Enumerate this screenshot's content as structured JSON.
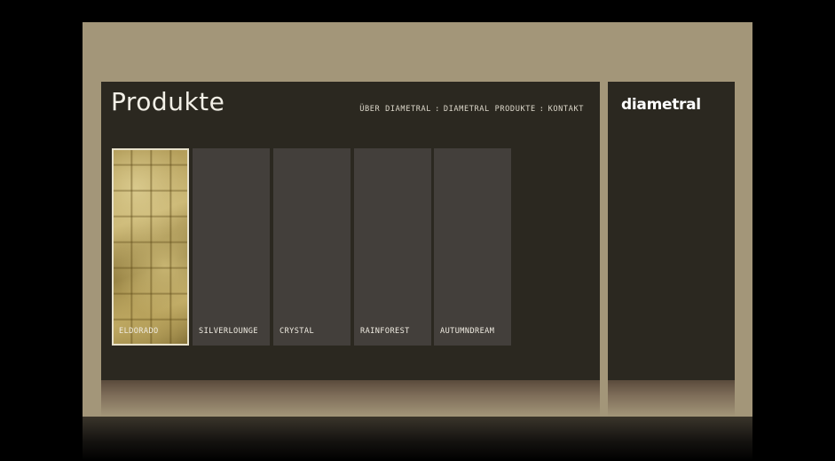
{
  "page": {
    "title": "Produkte"
  },
  "nav": {
    "items": [
      {
        "label": "ÜBER DIAMETRAL"
      },
      {
        "label": "DIAMETRAL PRODUKTE"
      },
      {
        "label": "KONTAKT"
      }
    ],
    "separator": ":"
  },
  "products": [
    {
      "label": "ELDORADO",
      "selected": true
    },
    {
      "label": "SILVERLOUNGE",
      "selected": false
    },
    {
      "label": "CRYSTAL",
      "selected": false
    },
    {
      "label": "RAINFOREST",
      "selected": false
    },
    {
      "label": "AUTUMNDREAM",
      "selected": false
    }
  ],
  "brand": {
    "logo_text": "diametral"
  },
  "colors": {
    "backdrop": "#000000",
    "frame": "#a39679",
    "panel": "#2b2820",
    "tile": "#433f3b",
    "text": "#f2efe6"
  }
}
